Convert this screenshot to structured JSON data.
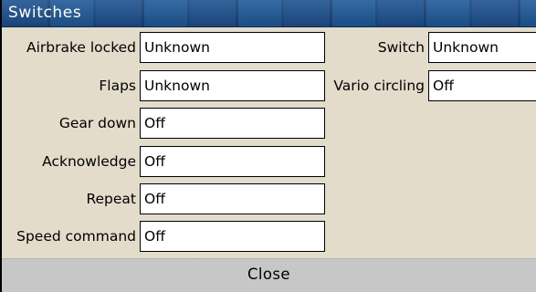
{
  "window": {
    "title": "Switches"
  },
  "left_column": [
    {
      "label": "Airbrake locked",
      "value": "Unknown"
    },
    {
      "label": "Flaps",
      "value": "Unknown"
    },
    {
      "label": "Gear down",
      "value": "Off"
    },
    {
      "label": "Acknowledge",
      "value": "Off"
    },
    {
      "label": "Repeat",
      "value": "Off"
    },
    {
      "label": "Speed command",
      "value": "Off"
    }
  ],
  "right_column": [
    {
      "label": "Switch",
      "value": "Unknown"
    },
    {
      "label": "Vario circling",
      "value": "Off"
    }
  ],
  "footer": {
    "close_label": "Close"
  },
  "colors": {
    "titlebar": "#1c4f8a",
    "background": "#e3dccb",
    "field": "#ffffff",
    "close_button": "#c7c7c7"
  }
}
